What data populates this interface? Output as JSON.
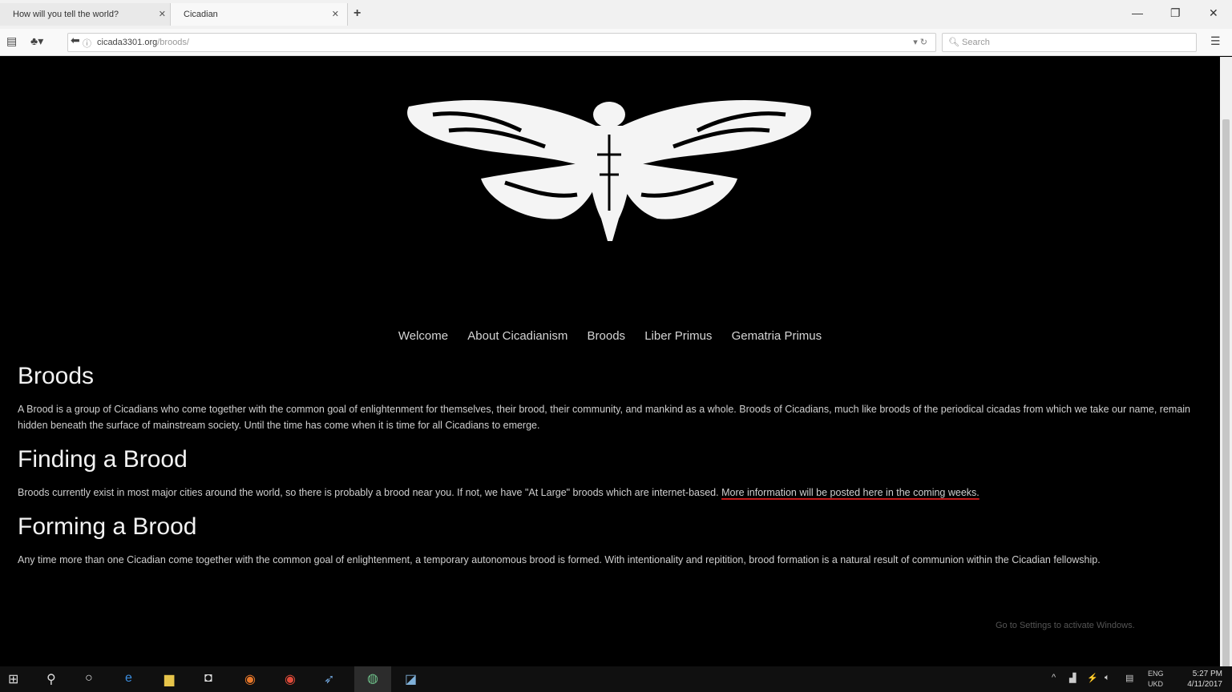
{
  "browser": {
    "tabs": [
      {
        "title": "How will you tell the world?"
      },
      {
        "title": "Cicadian"
      }
    ],
    "url_domain": "cicada3301.org",
    "url_path": "/broods/",
    "search_placeholder": "Search"
  },
  "site": {
    "nav": [
      "Welcome",
      "About Cicadianism",
      "Broods",
      "Liber Primus",
      "Gematria Primus"
    ],
    "sections": [
      {
        "heading": "Broods",
        "text": "A Brood is a group of Cicadians who come together with the common goal of enlightenment for themselves, their brood, their community, and mankind as a whole. Broods of Cicadians, much like broods of the periodical cicadas from which we take our name, remain hidden beneath the surface of mainstream society. Until the time has come when it is time for all Cicadians to emerge."
      },
      {
        "heading": "Finding a Brood",
        "text": "Broods currently exist in most major cities around the world, so there is probably a brood near you. If not, we have \"At Large\" broods which are internet-based. ",
        "link_text": "More information will be posted here in the coming weeks."
      },
      {
        "heading": "Forming a Brood",
        "text": "Any time more than one Cicadian come together with the common goal of enlightenment, a temporary autonomous brood is formed. With intentionality and repitition, brood formation is a natural result of communion within the Cicadian fellowship."
      }
    ]
  },
  "watermark": "Go to Settings to activate Windows.",
  "system": {
    "lang_top": "ENG",
    "lang_bottom": "UKD",
    "time": "5:27 PM",
    "date": "4/11/2017"
  },
  "colors": {
    "accent_underline": "#c41a1a",
    "page_bg": "#000000"
  }
}
